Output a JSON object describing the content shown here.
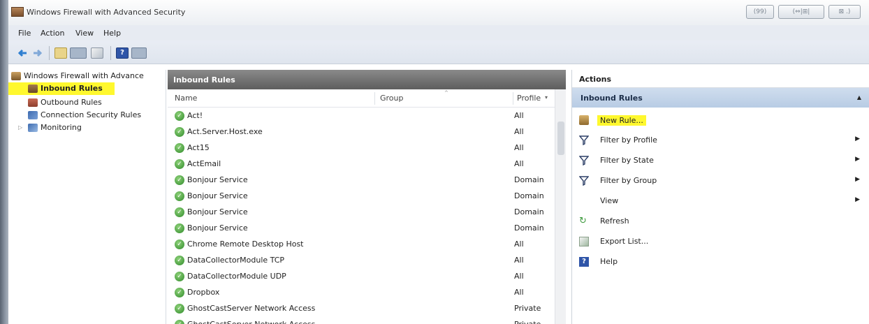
{
  "window": {
    "title": "Windows Firewall with Advanced Security",
    "caption_buttons": [
      "(99)",
      "(⇔|⊞|",
      "⊠ .)"
    ]
  },
  "menu": [
    "File",
    "Action",
    "View",
    "Help"
  ],
  "toolbar": {
    "icons": [
      "back-arrow-icon",
      "forward-arrow-icon",
      "show-hide-console-tree-icon",
      "properties-icon",
      "export-icon",
      "help-icon",
      "show-hide-action-pane-icon"
    ]
  },
  "tree": {
    "root": "Windows Firewall with Advance",
    "items": [
      "Inbound Rules",
      "Outbound Rules",
      "Connection Security Rules",
      "Monitoring"
    ]
  },
  "center": {
    "header": "Inbound Rules",
    "columns": [
      "Name",
      "Group",
      "Profile"
    ],
    "rows": [
      {
        "name": "Act!",
        "profile": "All"
      },
      {
        "name": "Act.Server.Host.exe",
        "profile": "All"
      },
      {
        "name": "Act15",
        "profile": "All"
      },
      {
        "name": "ActEmail",
        "profile": "All"
      },
      {
        "name": "Bonjour Service",
        "profile": "Domain"
      },
      {
        "name": "Bonjour Service",
        "profile": "Domain"
      },
      {
        "name": "Bonjour Service",
        "profile": "Domain"
      },
      {
        "name": "Bonjour Service",
        "profile": "Domain"
      },
      {
        "name": "Chrome Remote Desktop Host",
        "profile": "All"
      },
      {
        "name": "DataCollectorModule TCP",
        "profile": "All"
      },
      {
        "name": "DataCollectorModule UDP",
        "profile": "All"
      },
      {
        "name": "Dropbox",
        "profile": "All"
      },
      {
        "name": "GhostCastServer Network Access",
        "profile": "Private"
      },
      {
        "name": "GhostCastServer Network Access",
        "profile": "Private"
      }
    ]
  },
  "actions": {
    "title": "Actions",
    "group": "Inbound Rules",
    "items": [
      {
        "label": "New Rule...",
        "icon": "new-rule-icon",
        "submenu": false
      },
      {
        "label": "Filter by Profile",
        "icon": "filter-icon",
        "submenu": true
      },
      {
        "label": "Filter by State",
        "icon": "filter-icon",
        "submenu": true
      },
      {
        "label": "Filter by Group",
        "icon": "filter-icon",
        "submenu": true
      },
      {
        "label": "View",
        "icon": "",
        "submenu": true
      },
      {
        "label": "Refresh",
        "icon": "refresh-icon",
        "submenu": false
      },
      {
        "label": "Export List...",
        "icon": "export-list-icon",
        "submenu": false
      },
      {
        "label": "Help",
        "icon": "help-icon",
        "submenu": false
      }
    ]
  },
  "colors": {
    "highlight": "#fff82e",
    "action_group": "#c4d5ea",
    "center_header": "#6b6b6b"
  }
}
